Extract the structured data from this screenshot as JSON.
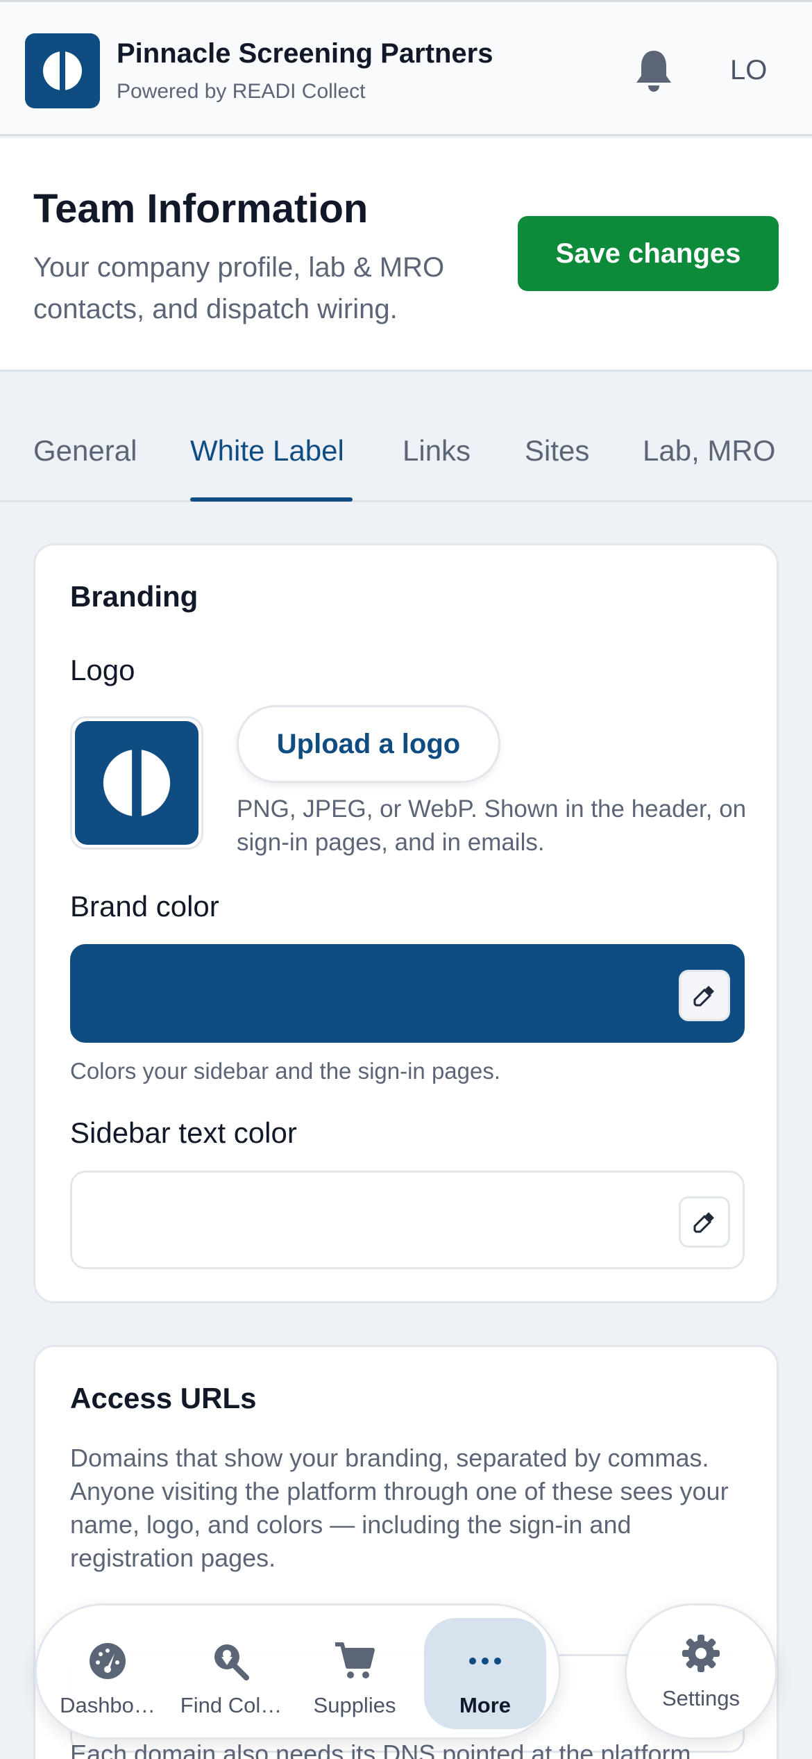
{
  "header": {
    "org_name": "Pinnacle Screening Partners",
    "org_subtitle": "Powered by READI Collect",
    "user_initials": "LO",
    "icons": {
      "logo": "readi-logo-icon",
      "notifications": "bell-icon"
    }
  },
  "page": {
    "title": "Team Information",
    "subtitle": "Your company profile, lab & MRO contacts, and dispatch wiring.",
    "save_label": "Save changes"
  },
  "tabs": [
    {
      "label": "General",
      "active": false
    },
    {
      "label": "White Label",
      "active": true
    },
    {
      "label": "Links",
      "active": false
    },
    {
      "label": "Sites",
      "active": false
    },
    {
      "label": "Lab, MRO",
      "active": false
    }
  ],
  "branding": {
    "title": "Branding",
    "logo_label": "Logo",
    "upload_label": "Upload a logo",
    "upload_hint": "PNG, JPEG, or WebP. Shown in the header, on sign-in pages, and in emails.",
    "brand_color_label": "Brand color",
    "brand_color_value": "#0f4c81",
    "brand_color_help": "Colors your sidebar and the sign-in pages.",
    "sidebar_text_color_label": "Sidebar text color",
    "sidebar_text_color_value": "#ffffff"
  },
  "access": {
    "title": "Access URLs",
    "description": "Domains that show your branding, separated by commas. Anyone visiting the platform through one of these sees your name, logo, and colors — including the sign-in and registration pages.",
    "dns_note": "Each domain also needs its DNS pointed at the platform."
  },
  "bottom_nav": {
    "items": [
      {
        "label": "Dashbo…",
        "icon": "dashboard-gauge-icon",
        "active": false
      },
      {
        "label": "Find Col…",
        "icon": "search-location-icon",
        "active": false
      },
      {
        "label": "Supplies",
        "icon": "cart-icon",
        "active": false
      },
      {
        "label": "More",
        "icon": "more-dots-icon",
        "active": true
      }
    ],
    "settings": {
      "label": "Settings",
      "icon": "gear-icon"
    }
  },
  "colors": {
    "brand": "#0f4c81",
    "primary_action": "#0e8a3b",
    "muted_text": "#5b6576"
  }
}
